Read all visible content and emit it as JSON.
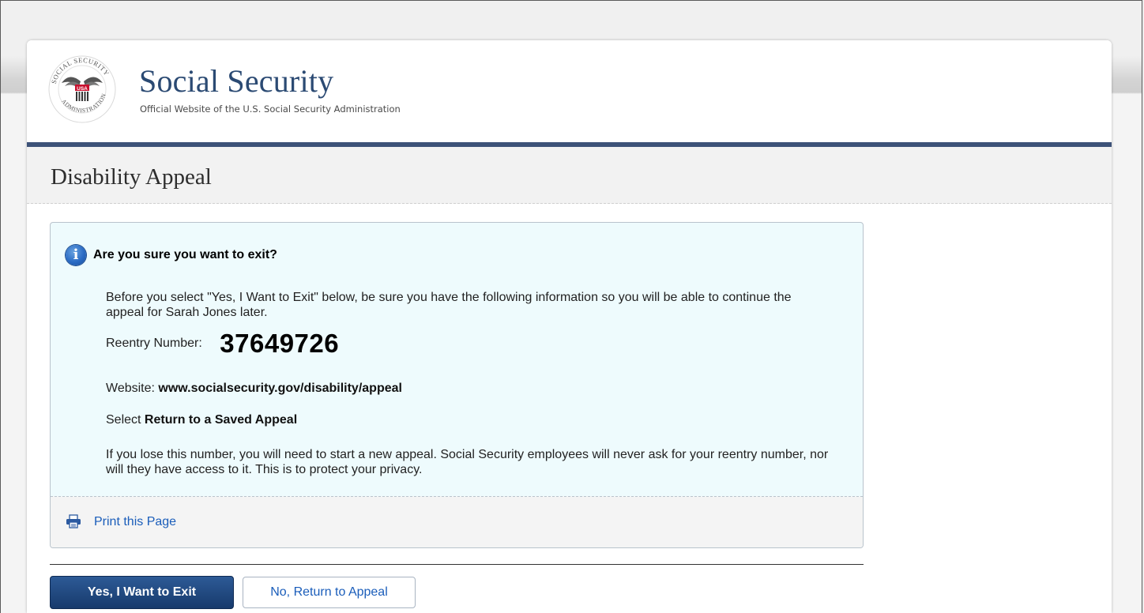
{
  "header": {
    "logo_text": "SOCIAL SECURITY ADMINISTRATION USA",
    "title": "Social Security",
    "subtitle": "Official Website of the U.S. Social Security Administration"
  },
  "page": {
    "title": "Disability Appeal"
  },
  "alert": {
    "heading": "Are you sure you want to exit?",
    "intro": "Before you select \"Yes, I Want to Exit\" below, be sure you have the following information so you will be able to continue the appeal for Sarah Jones later.",
    "reentry_label": "Reentry Number:",
    "reentry_number": "37649726",
    "website_label": "Website:",
    "website_value": "www.socialsecurity.gov/disability/appeal",
    "select_label": "Select",
    "select_value": "Return to a Saved Appeal",
    "warning": "If you lose this number, you will need to start a new appeal. Social Security employees will never ask for your reentry number, nor will they have access to it. This is to protect your privacy.",
    "print_link": "Print this Page"
  },
  "actions": {
    "exit_label": "Yes, I Want to Exit",
    "return_label": "No, Return to Appeal"
  },
  "colors": {
    "brand_navy": "#2b4a73",
    "header_bar": "#3d5278",
    "alert_bg": "#eefbfd",
    "link_blue": "#1a5dba",
    "primary_button": "#173a6c"
  },
  "icons": {
    "info": "info-icon",
    "print": "printer-icon",
    "logo": "ssa-seal-icon"
  }
}
